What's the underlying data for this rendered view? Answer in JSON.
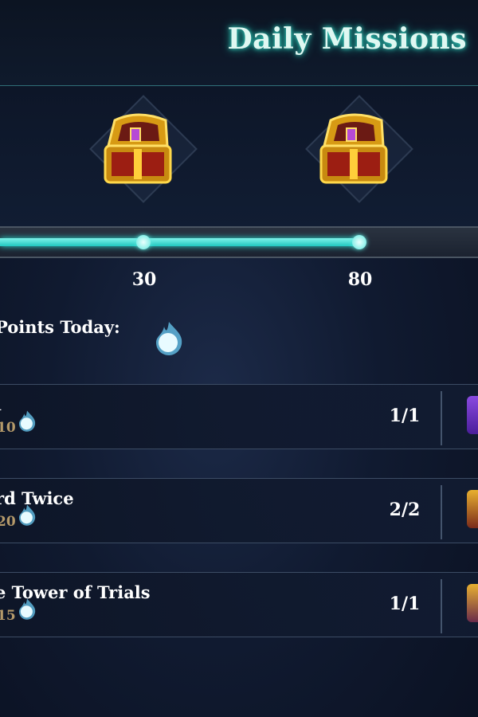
{
  "header": {
    "title": "Daily Missions"
  },
  "rewards": {
    "progress_fraction": 0.75,
    "milestones": [
      {
        "value": "30",
        "icon": "treasure-chest-icon"
      },
      {
        "value": "80",
        "icon": "treasure-chest-icon"
      }
    ]
  },
  "points_today": {
    "label": "Points Today:",
    "icon": "blue-flame-icon"
  },
  "missions": [
    {
      "name": "l",
      "points": "10",
      "progress": "1/1",
      "reward_icon": "purple-crystal-icon"
    },
    {
      "name": "rd Twice",
      "points": "20",
      "progress": "2/2",
      "reward_icon": "gold-chest-icon"
    },
    {
      "name": "e Tower of Trials",
      "points": "15",
      "progress": "1/1",
      "reward_icon": "gold-chest-icon"
    }
  ],
  "colors": {
    "accent": "#2de0d4",
    "title_glow": "#38e0cc",
    "points_text": "#b59a6a"
  }
}
